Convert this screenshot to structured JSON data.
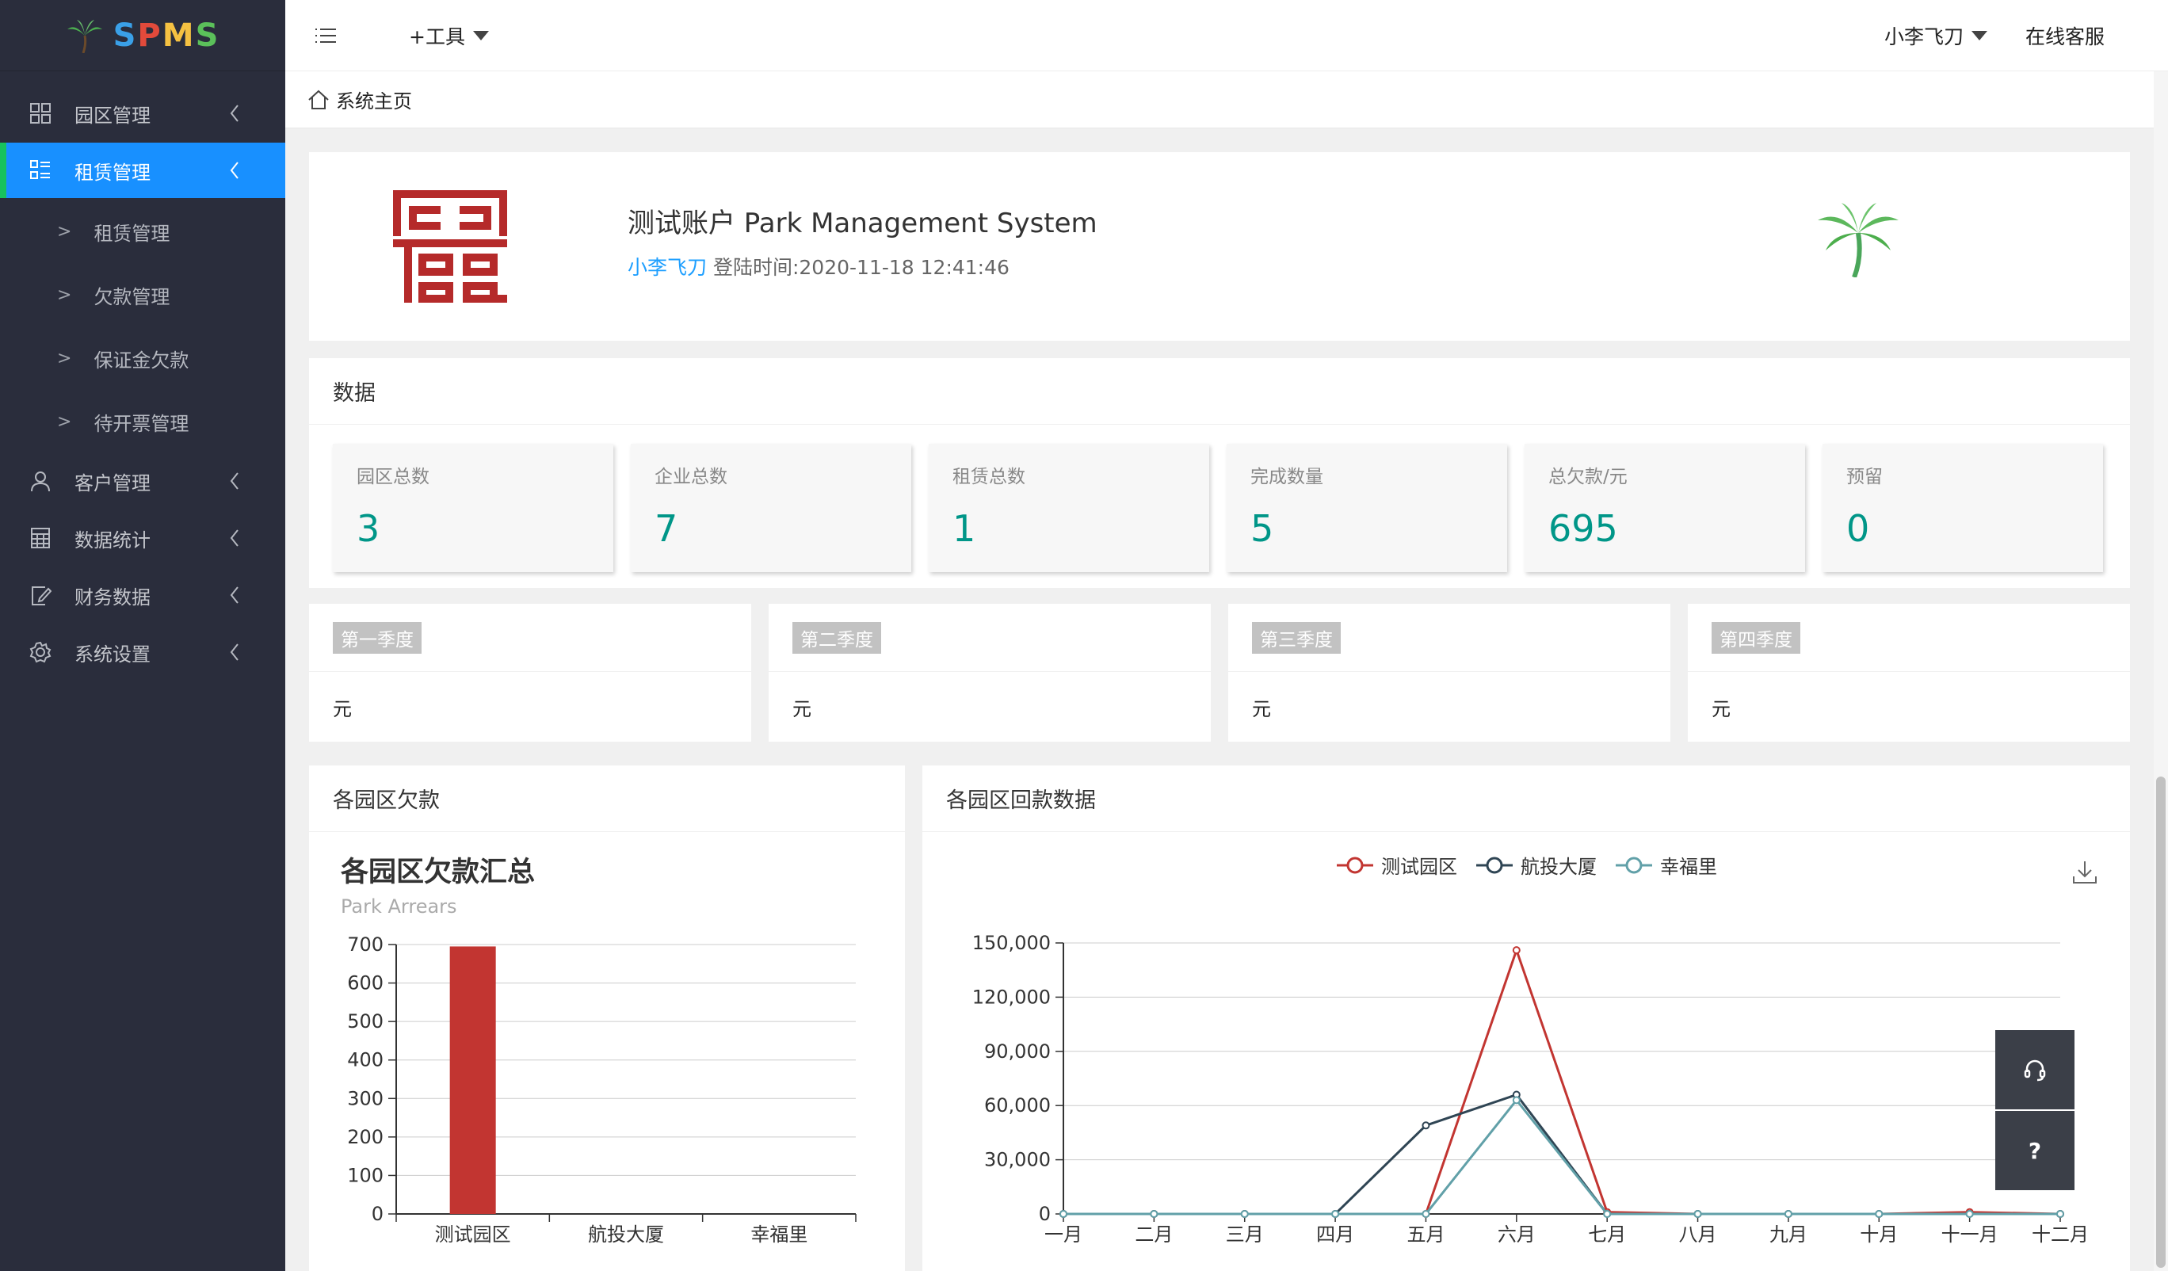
{
  "app": {
    "logo_text": [
      "S",
      "P",
      "M",
      "S"
    ]
  },
  "sidebar": {
    "items": [
      {
        "label": "园区管理"
      },
      {
        "label": "租赁管理"
      },
      {
        "label": "客户管理"
      },
      {
        "label": "数据统计"
      },
      {
        "label": "财务数据"
      },
      {
        "label": "系统设置"
      }
    ],
    "sub_items": [
      {
        "label": "租赁管理"
      },
      {
        "label": "欠款管理"
      },
      {
        "label": "保证金欠款"
      },
      {
        "label": "待开票管理"
      }
    ]
  },
  "header": {
    "tools_label": "+工具",
    "user_name": "小李飞刀",
    "service_label": "在线客服"
  },
  "breadcrumb": {
    "home": "系统主页"
  },
  "welcome": {
    "title": "测试账户 Park Management System",
    "user": "小李飞刀",
    "login_text": "登陆时间:2020-11-18 12:41:46"
  },
  "data_section": {
    "title": "数据",
    "stats": [
      {
        "label": "园区总数",
        "value": "3"
      },
      {
        "label": "企业总数",
        "value": "7"
      },
      {
        "label": "租赁总数",
        "value": "1"
      },
      {
        "label": "完成数量",
        "value": "5"
      },
      {
        "label": "总欠款/元",
        "value": "695"
      },
      {
        "label": "预留",
        "value": "0"
      }
    ]
  },
  "quarters": [
    {
      "label": "第一季度",
      "value": "元"
    },
    {
      "label": "第二季度",
      "value": "元"
    },
    {
      "label": "第三季度",
      "value": "元"
    },
    {
      "label": "第四季度",
      "value": "元"
    }
  ],
  "arrears_card": {
    "header": "各园区欠款"
  },
  "payback_card": {
    "header": "各园区回款数据"
  },
  "float_buttons": {
    "help": "?"
  },
  "colors": {
    "accent": "#1890ff",
    "stat_value": "#009688",
    "bar": "#c23531",
    "line1": "#c23531",
    "line2": "#2f4554",
    "line3": "#61a0a8"
  },
  "chart_data": [
    {
      "type": "bar",
      "title": "各园区欠款汇总",
      "subtitle": "Park Arrears",
      "categories": [
        "测试园区",
        "航投大厦",
        "幸福里"
      ],
      "values": [
        695,
        0,
        0
      ],
      "ylim": [
        0,
        700
      ],
      "yticks": [
        0,
        100,
        200,
        300,
        400,
        500,
        600,
        700
      ],
      "grid": true
    },
    {
      "type": "line",
      "categories": [
        "一月",
        "二月",
        "三月",
        "四月",
        "五月",
        "六月",
        "七月",
        "八月",
        "九月",
        "十月",
        "十一月",
        "十二月"
      ],
      "series": [
        {
          "name": "测试园区",
          "color": "#c23531",
          "values": [
            0,
            0,
            0,
            0,
            0,
            146000,
            1000,
            0,
            0,
            0,
            1000,
            0
          ]
        },
        {
          "name": "航投大厦",
          "color": "#2f4554",
          "values": [
            0,
            0,
            0,
            0,
            49000,
            66000,
            0,
            0,
            0,
            0,
            0,
            0
          ]
        },
        {
          "name": "幸福里",
          "color": "#61a0a8",
          "values": [
            0,
            0,
            0,
            0,
            0,
            63000,
            0,
            0,
            0,
            0,
            0,
            0
          ]
        }
      ],
      "ylim": [
        0,
        150000
      ],
      "yticks": [
        "0",
        "30,000",
        "60,000",
        "90,000",
        "120,000",
        "150,000"
      ],
      "legend": "top-center",
      "grid": true
    }
  ]
}
